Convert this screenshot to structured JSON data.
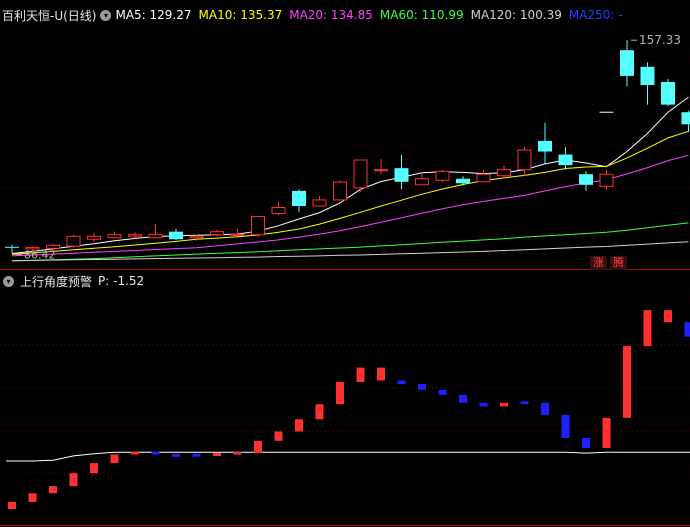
{
  "top_legend": {
    "title": "百利天恒-U(日线)",
    "ma": [
      {
        "label": "MA5:",
        "value": "129.27",
        "color": "#ffffff"
      },
      {
        "label": "MA10:",
        "value": "135.37",
        "color": "#ffff00"
      },
      {
        "label": "MA20:",
        "value": "134.85",
        "color": "#ff40ff"
      },
      {
        "label": "MA60:",
        "value": "110.99",
        "color": "#40ff40"
      },
      {
        "label": "MA120:",
        "value": "100.39",
        "color": "#d0d0d0"
      },
      {
        "label": "MA250:",
        "value": "-",
        "color": "#2040ff"
      }
    ]
  },
  "bottom_legend": {
    "title": "上行角度预警",
    "param": "P: -1.52"
  },
  "badges": [
    "涨",
    "腾"
  ],
  "colors": {
    "up": "#ff3030",
    "down": "#54ffff",
    "neg_bar": "#2020ff",
    "grid": "#7a0000"
  },
  "chart_data": [
    {
      "type": "candlestick",
      "title": "百利天恒-U(日线)",
      "ylim": [
        82,
        162
      ],
      "annotations": [
        {
          "label": "157.33",
          "x": 30
        },
        {
          "label": "86.42",
          "x": 0
        }
      ],
      "candles": [
        {
          "o": 89.0,
          "h": 89.6,
          "l": 87.0,
          "c": 88.7
        },
        {
          "o": 88.3,
          "h": 89.2,
          "l": 86.4,
          "c": 88.8
        },
        {
          "o": 88.5,
          "h": 90.0,
          "l": 87.5,
          "c": 89.5
        },
        {
          "o": 89.2,
          "h": 93.0,
          "l": 88.7,
          "c": 92.5
        },
        {
          "o": 91.5,
          "h": 93.6,
          "l": 90.5,
          "c": 92.5
        },
        {
          "o": 92.0,
          "h": 94.0,
          "l": 91.8,
          "c": 93.0
        },
        {
          "o": 92.5,
          "h": 93.8,
          "l": 91.8,
          "c": 93.0
        },
        {
          "o": 92.0,
          "h": 96.5,
          "l": 91.8,
          "c": 93.1
        },
        {
          "o": 94.0,
          "h": 95.0,
          "l": 91.2,
          "c": 91.5
        },
        {
          "o": 92.0,
          "h": 93.0,
          "l": 91.0,
          "c": 92.5
        },
        {
          "o": 93.0,
          "h": 94.6,
          "l": 92.5,
          "c": 94.0
        },
        {
          "o": 93.0,
          "h": 95.0,
          "l": 92.5,
          "c": 93.1
        },
        {
          "o": 93.0,
          "h": 99.0,
          "l": 92.2,
          "c": 99.0
        },
        {
          "o": 100.0,
          "h": 104.0,
          "l": 99.4,
          "c": 102.0
        },
        {
          "o": 107.5,
          "h": 108.0,
          "l": 100.5,
          "c": 102.5
        },
        {
          "o": 102.5,
          "h": 105.8,
          "l": 102.5,
          "c": 104.5
        },
        {
          "o": 104.5,
          "h": 111.0,
          "l": 104.5,
          "c": 110.4
        },
        {
          "o": 108.5,
          "h": 117.7,
          "l": 107.2,
          "c": 117.7
        },
        {
          "o": 114.5,
          "h": 118.0,
          "l": 113.0,
          "c": 114.5
        },
        {
          "o": 115.0,
          "h": 119.5,
          "l": 108.0,
          "c": 110.5
        },
        {
          "o": 109.5,
          "h": 113.5,
          "l": 109.5,
          "c": 111.5
        },
        {
          "o": 111.0,
          "h": 114.5,
          "l": 110.5,
          "c": 114.0
        },
        {
          "o": 111.5,
          "h": 112.3,
          "l": 109.2,
          "c": 110.0
        },
        {
          "o": 110.5,
          "h": 114.5,
          "l": 110.5,
          "c": 113.0
        },
        {
          "o": 112.5,
          "h": 116.0,
          "l": 111.5,
          "c": 114.5
        },
        {
          "o": 114.5,
          "h": 122.0,
          "l": 112.5,
          "c": 121.0
        },
        {
          "o": 124.0,
          "h": 130.0,
          "l": 116.5,
          "c": 120.5
        },
        {
          "o": 119.5,
          "h": 122.0,
          "l": 114.5,
          "c": 116.0
        },
        {
          "o": 113.0,
          "h": 114.0,
          "l": 107.5,
          "c": 109.5
        },
        {
          "o": 109.0,
          "h": 114.5,
          "l": 108.0,
          "c": 113.0
        },
        {
          "o": 154.0,
          "h": 157.3,
          "l": 142.0,
          "c": 145.5
        },
        {
          "o": 148.5,
          "h": 150.0,
          "l": 136.0,
          "c": 142.5
        },
        {
          "o": 143.5,
          "h": 144.5,
          "l": 135.5,
          "c": 136.0
        },
        {
          "o": 133.5,
          "h": 134.0,
          "l": 127.0,
          "c": 129.5
        }
      ],
      "marker": {
        "x": 29,
        "y": 133.5
      },
      "ma_series": [
        {
          "name": "MA5",
          "color": "#ffffff",
          "values": [
            86.8,
            87.5,
            88.3,
            89.2,
            90.0,
            91.0,
            91.8,
            92.4,
            92.6,
            92.8,
            93.0,
            93.2,
            94.2,
            96.0,
            98.2,
            100.3,
            103.5,
            108.0,
            110.6,
            112.0,
            113.5,
            113.8,
            113.6,
            113.2,
            113.5,
            114.5,
            116.4,
            117.7,
            116.7,
            115.5,
            120.5,
            126.5,
            133.5,
            138.5
          ]
        },
        {
          "name": "MA10",
          "color": "#ffff00",
          "values": [
            86.5,
            87.0,
            87.5,
            88.0,
            88.5,
            89.0,
            89.6,
            90.2,
            90.8,
            91.5,
            91.9,
            92.3,
            92.9,
            93.8,
            94.9,
            96.5,
            98.4,
            100.4,
            102.5,
            104.4,
            106.4,
            108.1,
            109.6,
            110.9,
            111.8,
            112.6,
            113.6,
            114.9,
            115.4,
            115.6,
            118.4,
            121.6,
            125.0,
            127.2
          ]
        },
        {
          "name": "MA20",
          "color": "#ff40ff",
          "values": [
            86.0,
            86.3,
            86.6,
            86.9,
            87.2,
            87.5,
            87.8,
            88.1,
            88.4,
            88.7,
            89.3,
            90.0,
            90.6,
            91.3,
            92.2,
            93.2,
            94.3,
            95.7,
            97.1,
            98.6,
            100.1,
            101.6,
            102.9,
            104.0,
            105.0,
            106.0,
            107.5,
            108.9,
            110.1,
            111.2,
            113.1,
            115.2,
            117.5,
            119.3
          ]
        },
        {
          "name": "MA60",
          "color": "#40ff40",
          "values": [
            84.3,
            84.5,
            84.7,
            84.9,
            85.1,
            85.4,
            85.7,
            86.0,
            86.3,
            86.6,
            86.9,
            87.1,
            87.4,
            87.7,
            88.0,
            88.3,
            88.6,
            88.9,
            89.3,
            89.7,
            90.1,
            90.5,
            90.9,
            91.3,
            91.7,
            92.2,
            92.6,
            93.0,
            93.4,
            93.8,
            94.5,
            95.3,
            96.1,
            96.9
          ]
        },
        {
          "name": "MA120",
          "color": "#d0d0d0",
          "values": [
            84.4,
            84.5,
            84.6,
            84.7,
            84.8,
            84.9,
            85.0,
            85.1,
            85.2,
            85.3,
            85.4,
            85.5,
            85.6,
            85.8,
            85.9,
            86.0,
            86.2,
            86.3,
            86.5,
            86.7,
            86.9,
            87.1,
            87.3,
            87.5,
            87.8,
            88.0,
            88.3,
            88.6,
            88.9,
            89.1,
            89.5,
            89.9,
            90.3,
            90.7
          ]
        }
      ]
    },
    {
      "type": "bar",
      "title": "上行角度预警",
      "ylim": [
        -1.9,
        1.4
      ],
      "values": [
        -1.62,
        -1.5,
        -1.4,
        -1.22,
        -1.08,
        -0.96,
        -0.94,
        -0.94,
        -0.97,
        -0.97,
        -0.96,
        -0.94,
        -0.77,
        -0.64,
        -0.47,
        -0.26,
        0.05,
        0.25,
        0.07,
        0.02,
        -0.06,
        -0.13,
        -0.24,
        -0.29,
        -0.24,
        -0.24,
        -0.41,
        -0.73,
        -0.87,
        -0.45,
        0.55,
        1.05,
        0.88,
        0.68
      ],
      "colors": [
        "up",
        "up",
        "up",
        "up",
        "up",
        "up",
        "up",
        "neg",
        "neg",
        "neg",
        "up",
        "up",
        "up",
        "up",
        "up",
        "up",
        "up",
        "up",
        "up",
        "neg",
        "neg",
        "neg",
        "neg",
        "neg",
        "up",
        "neg",
        "neg",
        "neg",
        "neg",
        "up",
        "up",
        "up",
        "up",
        "neg"
      ],
      "line_values": [
        -1.05,
        -1.05,
        -1.04,
        -0.98,
        -0.95,
        -0.93,
        -0.93,
        -0.93,
        -0.93,
        -0.93,
        -0.93,
        -0.93,
        -0.93,
        -0.93,
        -0.93,
        -0.93,
        -0.93,
        -0.93,
        -0.93,
        -0.93,
        -0.93,
        -0.93,
        -0.93,
        -0.93,
        -0.93,
        -0.93,
        -0.93,
        -0.93,
        -0.94,
        -0.93,
        -0.93,
        -0.93,
        -0.93,
        -0.93
      ]
    }
  ]
}
